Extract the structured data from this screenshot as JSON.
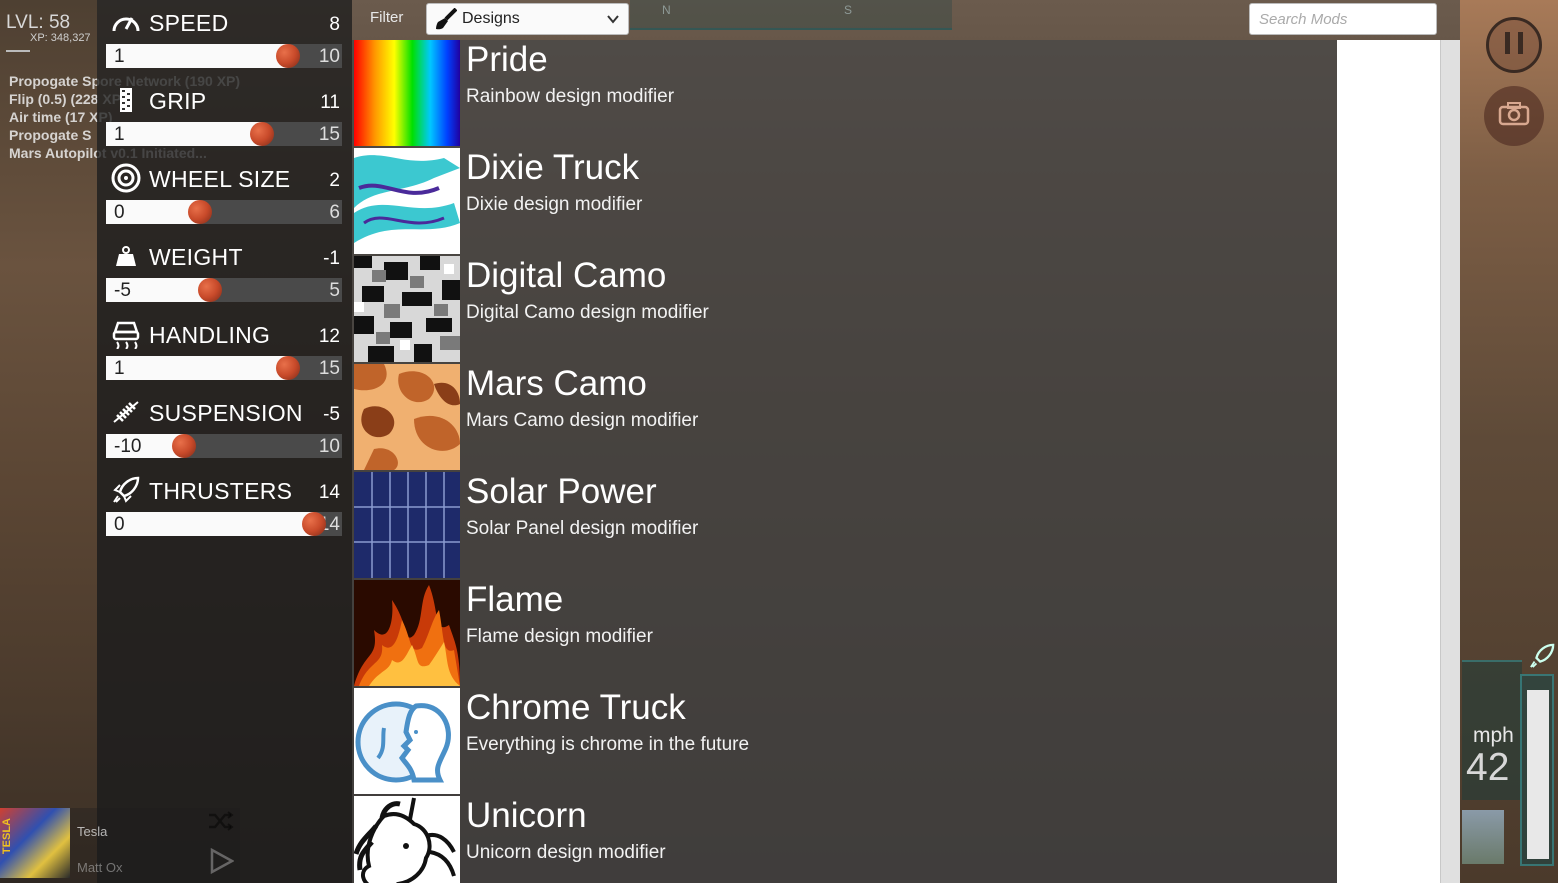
{
  "hud": {
    "level": "LVL: 58",
    "xp": "XP: 348,327"
  },
  "log": [
    "Propogate Spore Network (190 XP)",
    "Flip (0.5) (228 XP)",
    "Air time (17 XP)",
    "Propogate S",
    "Mars Autopilot v0.1 Initiated..."
  ],
  "stats": [
    {
      "name": "SPEED",
      "icon": "speedometer-icon",
      "current": "8",
      "min": "1",
      "max": "10",
      "fill": 0.77
    },
    {
      "name": "GRIP",
      "icon": "tire-tread-icon",
      "current": "11",
      "min": "1",
      "max": "15",
      "fill": 0.66
    },
    {
      "name": "WHEEL SIZE",
      "icon": "wheel-icon",
      "current": "2",
      "min": "0",
      "max": "6",
      "fill": 0.4
    },
    {
      "name": "WEIGHT",
      "icon": "weight-icon",
      "current": "-1",
      "min": "-5",
      "max": "5",
      "fill": 0.44
    },
    {
      "name": "HANDLING",
      "icon": "handling-icon",
      "current": "12",
      "min": "1",
      "max": "15",
      "fill": 0.77
    },
    {
      "name": "SUSPENSION",
      "icon": "spring-icon",
      "current": "-5",
      "min": "-10",
      "max": "10",
      "fill": 0.33
    },
    {
      "name": "THRUSTERS",
      "icon": "rocket-icon",
      "current": "14",
      "min": "0",
      "max": "14",
      "fill": 0.88
    }
  ],
  "filter": {
    "label": "Filter",
    "selected": "Designs",
    "icon": "paint-brush-icon"
  },
  "compass": [
    "N",
    "S"
  ],
  "search": {
    "placeholder": "Search Mods",
    "value": ""
  },
  "mods": [
    {
      "title": "Pride",
      "desc": "Rainbow design modifier",
      "thumb": "rainbow"
    },
    {
      "title": "Dixie Truck",
      "desc": "Dixie design modifier",
      "thumb": "dixie"
    },
    {
      "title": "Digital Camo",
      "desc": "Digital Camo design modifier",
      "thumb": "digicamo"
    },
    {
      "title": "Mars Camo",
      "desc": "Mars Camo design modifier",
      "thumb": "marscamo"
    },
    {
      "title": "Solar Power",
      "desc": "Solar Panel design modifier",
      "thumb": "solar"
    },
    {
      "title": "Flame",
      "desc": "Flame design modifier",
      "thumb": "flame"
    },
    {
      "title": "Chrome Truck",
      "desc": "Everything is chrome in the future",
      "thumb": "chrome"
    },
    {
      "title": "Unicorn",
      "desc": "Unicorn design modifier",
      "thumb": "unicorn"
    }
  ],
  "speedometer": {
    "unit": "mph",
    "value": "42",
    "thrust_level": 0.95
  },
  "music": {
    "album_text": "TESLA",
    "artist": "Tesla",
    "title": "Matt Ox"
  },
  "colors": {
    "knob": "#c84a2a",
    "panel_accent": "#3c8c8c"
  }
}
